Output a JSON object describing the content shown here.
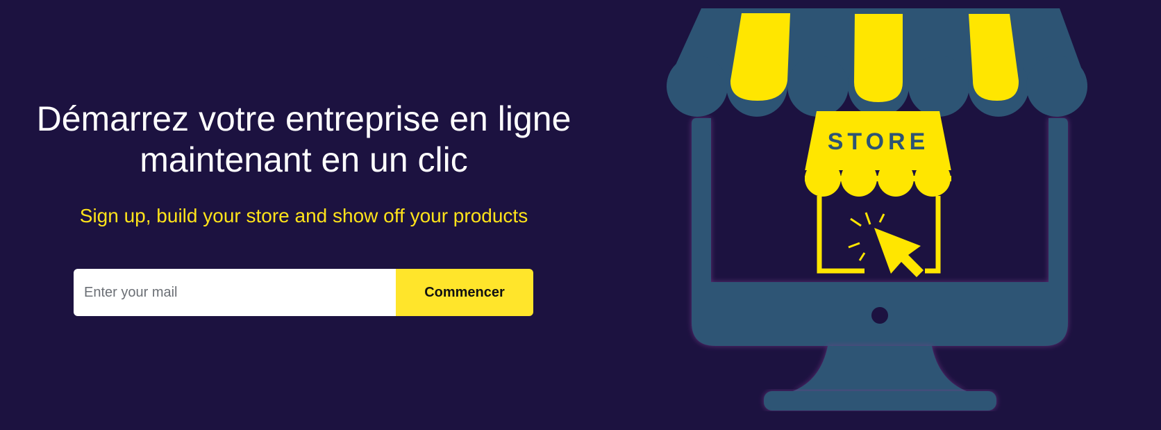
{
  "hero": {
    "headline": "Démarrez votre entreprise en ligne maintenant en un clic",
    "subheadline": "Sign up, build your store and show off your products"
  },
  "signup": {
    "email_placeholder": "Enter your mail",
    "email_value": "",
    "submit_label": "Commencer"
  },
  "illustration": {
    "store_sign": "STORE"
  },
  "colors": {
    "background": "#1c1240",
    "accent_yellow": "#ffe31a",
    "monitor_blue": "#2d5474",
    "headline_text": "#ffffff"
  }
}
